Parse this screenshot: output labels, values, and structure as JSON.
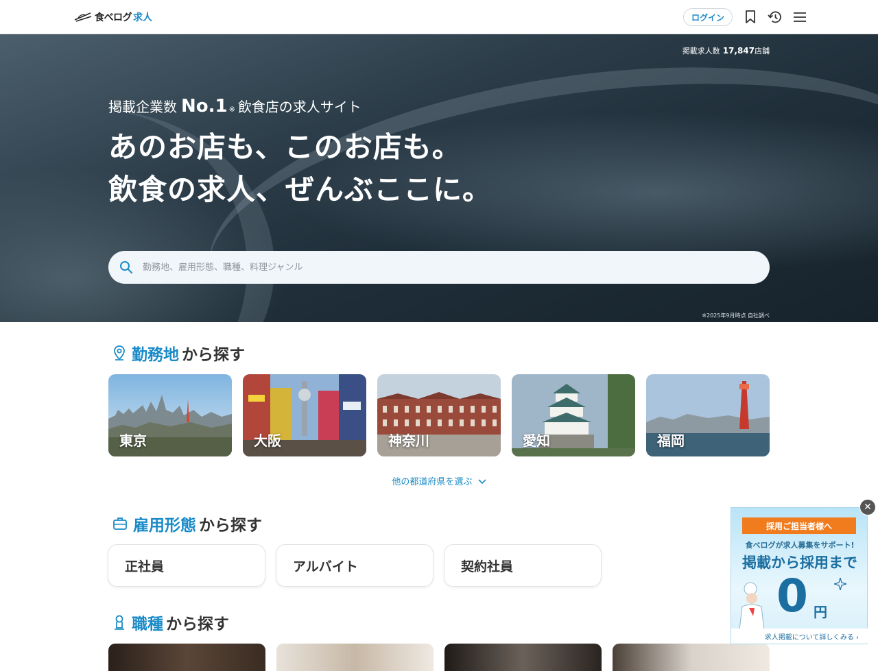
{
  "header": {
    "logo_main": "食べログ",
    "logo_sub": "求人",
    "login_label": "ログイン"
  },
  "hero": {
    "count_label": "掲載求人数",
    "count_value": "17,847",
    "count_unit": "店舗",
    "tagline_pre": "掲載企業数",
    "tagline_no1": "No.1",
    "tagline_mark": "※",
    "tagline_post": "飲食店の求人サイト",
    "headline_line1": "あのお店も、このお店も。",
    "headline_line2": "飲食の求人、ぜんぶここに。",
    "search_placeholder": "勤務地、雇用形態、職種、料理ジャンル",
    "note": "※2025年9月時点 自社調べ"
  },
  "areas": {
    "heading_accent": "勤務地",
    "heading_rest": "から探す",
    "items": [
      {
        "label": "東京"
      },
      {
        "label": "大阪"
      },
      {
        "label": "神奈川"
      },
      {
        "label": "愛知"
      },
      {
        "label": "福岡"
      }
    ],
    "more_label": "他の都道府県を選ぶ"
  },
  "employment": {
    "heading_accent": "雇用形態",
    "heading_rest": "から探す",
    "items": [
      {
        "label": "正社員"
      },
      {
        "label": "アルバイト"
      },
      {
        "label": "契約社員"
      }
    ]
  },
  "jobs": {
    "heading_accent": "職種",
    "heading_rest": "から探す"
  },
  "ad": {
    "badge": "採用ご担当者様へ",
    "line1": "食べログが求人募集をサポート!",
    "line2": "掲載から採用まで",
    "zero": "0",
    "yen": "円",
    "bottom": "求人掲載について詳しくみる ›"
  },
  "colors": {
    "accent": "#1a8bc8",
    "ad_orange": "#f07c1e"
  }
}
